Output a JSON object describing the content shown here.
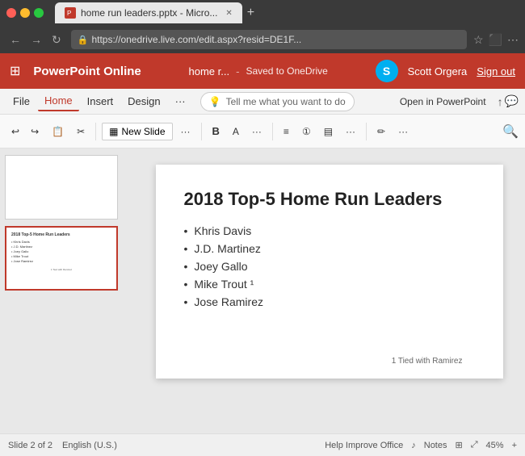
{
  "browser": {
    "tab_title": "home run leaders.pptx - Micro...",
    "url": "https://onedrive.live.com/edit.aspx?resid=DE1F...",
    "new_tab_label": "+"
  },
  "app_bar": {
    "app_name": "PowerPoint Online",
    "doc_filename": "home r...",
    "separator": "-",
    "saved_status": "Saved to OneDrive",
    "skype_letter": "S",
    "user_name": "Scott Orgera",
    "sign_out": "Sign out"
  },
  "menu": {
    "items": [
      "File",
      "Home",
      "Insert",
      "Design"
    ],
    "active": "Home",
    "tell_me_placeholder": "Tell me what you want to do",
    "open_in_ppt": "Open in PowerPoint"
  },
  "ribbon": {
    "new_slide": "New Slide",
    "bold": "B",
    "undo": "↩",
    "redo": "↪"
  },
  "slides": [
    {
      "number": "1",
      "is_blank": true,
      "selected": false
    },
    {
      "number": "2",
      "is_blank": false,
      "selected": true,
      "title": "2018 Top-5 Home Run Leaders",
      "bullets": [
        "Khris Davis",
        "J.D. Martinez",
        "Joey Gallo",
        "Mike Trout",
        "Jose Ramirez"
      ],
      "footnote": "1 Tied with Ramirez"
    }
  ],
  "slide_content": {
    "title": "2018 Top-5 Home Run Leaders",
    "bullets": [
      "Khris Davis",
      "J.D. Martinez",
      "Joey Gallo",
      "Mike Trout ¹",
      "Jose Ramirez"
    ],
    "footnote": "1 Tied with Ramirez"
  },
  "status_bar": {
    "slide_info": "Slide 2 of 2",
    "language": "English (U.S.)",
    "help": "Help Improve Office",
    "notes": "Notes",
    "zoom": "45%"
  },
  "colors": {
    "brand_red": "#C0392B",
    "skype_blue": "#00aff0"
  }
}
